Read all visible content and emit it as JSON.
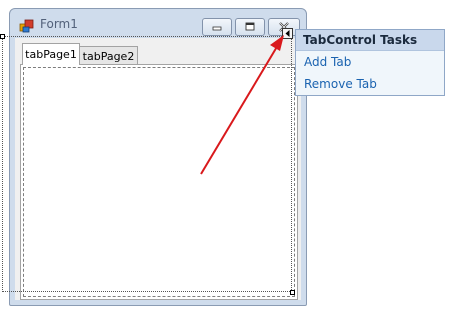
{
  "window": {
    "title": "Form1",
    "icon": "form-app-icon",
    "caption_buttons": [
      "minimize-icon",
      "maximize-icon",
      "close-icon"
    ]
  },
  "tab_control": {
    "tabs": [
      {
        "label": "tabPage1",
        "selected": true
      },
      {
        "label": "tabPage2",
        "selected": false
      }
    ]
  },
  "smart_tag": {
    "icon": "smart-tag-arrow-icon"
  },
  "tasks_panel": {
    "title": "TabControl Tasks",
    "items": [
      {
        "label": "Add Tab"
      },
      {
        "label": "Remove Tab"
      }
    ]
  },
  "colors": {
    "annotation_arrow": "#d9191c",
    "link": "#1b63b0",
    "panel_header": "#c9d8ec"
  }
}
